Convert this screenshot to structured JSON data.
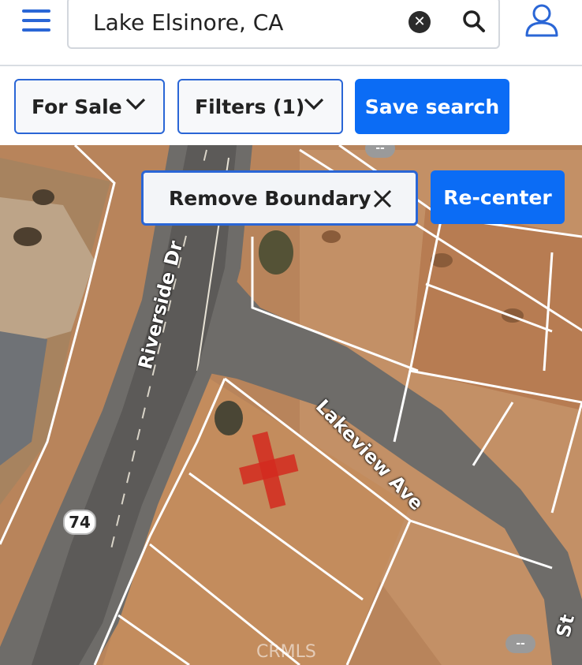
{
  "header": {
    "search_value": "Lake Elsinore, CA",
    "clear_label": "✕",
    "icons": [
      "menu-icon",
      "clear-icon",
      "search-icon",
      "user-icon"
    ]
  },
  "filters": {
    "for_sale_label": "For Sale",
    "filters_label": "Filters (1)",
    "save_search_label": "Save search"
  },
  "map": {
    "remove_boundary_label": "Remove Boundary",
    "recenter_label": "Re-center",
    "street_labels": [
      "Riverside Dr",
      "Lakeview Ave",
      "St"
    ],
    "route_number": "74",
    "placeholder_badges": [
      "--",
      "--"
    ],
    "watermark": "CRMLS",
    "colors": {
      "accent": "#0b6cf5",
      "border_accent": "#2a66d6",
      "marker": "#d42a1e"
    }
  }
}
